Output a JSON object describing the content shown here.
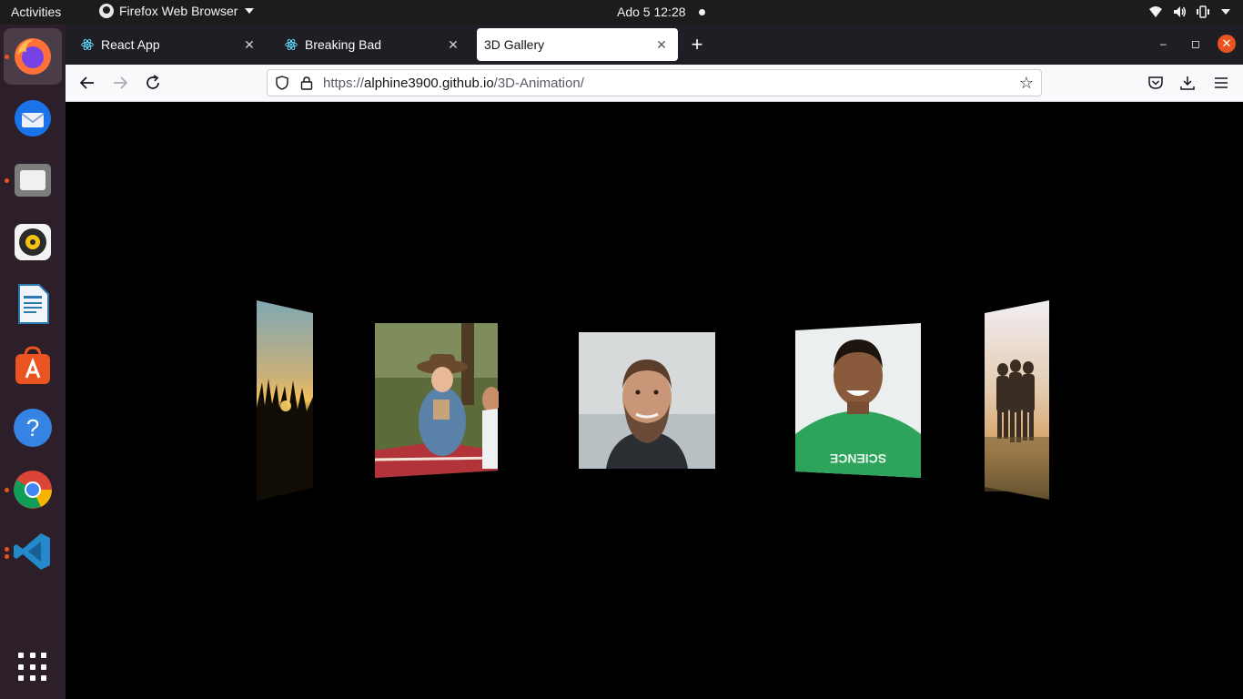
{
  "topbar": {
    "activities": "Activities",
    "app_name": "Firefox Web Browser",
    "clock": "Ado 5  12:28"
  },
  "dock": {
    "apps": [
      {
        "name": "Firefox",
        "color": "#ff7139"
      },
      {
        "name": "Thunderbird",
        "color": "#1a73e8"
      },
      {
        "name": "Files",
        "color": "#8f8f8f"
      },
      {
        "name": "Rhythmbox",
        "color": "#f5c211"
      },
      {
        "name": "LibreOffice Writer",
        "color": "#2a7ab0"
      },
      {
        "name": "Ubuntu Software",
        "color": "#e95420"
      },
      {
        "name": "Help",
        "color": "#3584e4"
      },
      {
        "name": "Google Chrome",
        "color": "#4285f4"
      },
      {
        "name": "Visual Studio Code",
        "color": "#2489ca"
      }
    ]
  },
  "browser": {
    "tabs": [
      {
        "label": "React App",
        "selected": false
      },
      {
        "label": "Breaking Bad",
        "selected": false
      },
      {
        "label": "3D Gallery",
        "selected": true
      }
    ],
    "url_scheme": "https://",
    "url_host": "alphine3900.github.io",
    "url_path": "/3D-Animation/"
  },
  "gallery": {
    "images": [
      {
        "name": "sunset-hands-photo",
        "subject": "silhouetted raised hands at sunset"
      },
      {
        "name": "picnic-woman-photo",
        "subject": "woman in hat holding a book at a picnic"
      },
      {
        "name": "bearded-man-photo",
        "subject": "smiling bearded man by the sea"
      },
      {
        "name": "green-shirt-man-photo",
        "subject": "smiling man in green science t-shirt"
      },
      {
        "name": "friends-group-photo",
        "subject": "group of friends hugging in a field"
      }
    ]
  }
}
